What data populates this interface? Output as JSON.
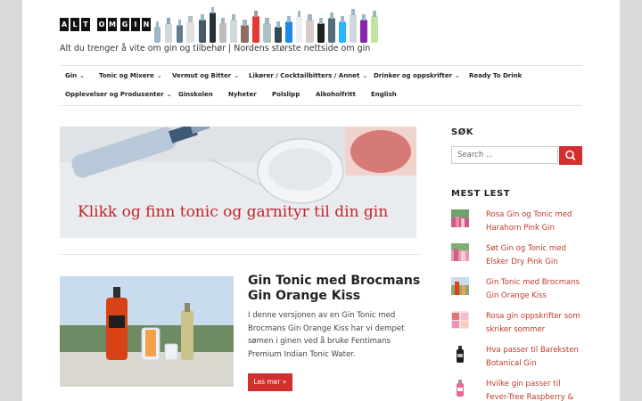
{
  "site": {
    "logo_letters": [
      "A",
      "L",
      "T",
      "O",
      "M",
      "G",
      "I",
      "N"
    ],
    "tagline": "Alt du trenger å vite om gin og tilbehør | Nordens største nettside om gin"
  },
  "nav": {
    "row1": [
      {
        "label": "Gin",
        "dropdown": true
      },
      {
        "label": "Tonic og Mixere",
        "dropdown": true
      },
      {
        "label": "Vermut og Bitter",
        "dropdown": true
      },
      {
        "label": "Likører / Cocktailbitters / Annet",
        "dropdown": true
      },
      {
        "label": "Drinker og oppskrifter",
        "dropdown": true
      },
      {
        "label": "Ready To Drink",
        "dropdown": false
      }
    ],
    "row2": [
      {
        "label": "Opplevelser og Produsenter",
        "dropdown": true
      },
      {
        "label": "Ginskolen",
        "dropdown": false
      },
      {
        "label": "Nyheter",
        "dropdown": false
      },
      {
        "label": "Polslipp",
        "dropdown": false
      },
      {
        "label": "Alkoholfritt",
        "dropdown": false
      },
      {
        "label": "English",
        "dropdown": false
      }
    ]
  },
  "banner": {
    "text": "Klikk og finn tonic og garnityr til din gin"
  },
  "post": {
    "title": "Gin Tonic med Brocmans Gin Orange Kiss",
    "excerpt": "I denne versjonen av en Gin Tonic med Brocmans Gin Orange Kiss har vi dempet sømen i ginen ved å bruke Fentimans Premium Indian Tonic Water.",
    "read_more": "Les mer »"
  },
  "sidebar": {
    "search_heading": "SØK",
    "search_placeholder": "Search ...",
    "popular_heading": "MEST LEST",
    "popular": [
      {
        "title": "Rosa Gin og Tonic med Harahorn Pink Gin",
        "thumb": "pink"
      },
      {
        "title": "Søt Gin og Tonic med Elsker Dry Pink Gin",
        "thumb": "pink2"
      },
      {
        "title": "Gin Tonic med Brocmans Gin Orange Kiss",
        "thumb": "orange"
      },
      {
        "title": "Rosa gin oppskrifter som skriker sommer",
        "thumb": "mixed"
      },
      {
        "title": "Hva passer til Bareksten Botanical Gin",
        "thumb": "dark-bottle"
      },
      {
        "title": "Hvilke gin passer til Fever-Tree Raspberry &",
        "thumb": "pink-bottle"
      }
    ]
  },
  "colors": {
    "accent": "#d32f2f",
    "link": "#c0392b",
    "background": "#d9d9d9"
  }
}
